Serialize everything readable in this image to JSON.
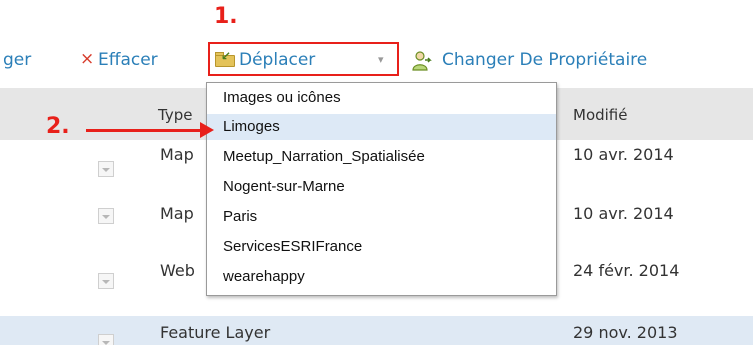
{
  "annotations": {
    "step1": "1.",
    "step2": "2."
  },
  "toolbar": {
    "partial_label": "ger",
    "delete_icon": "×",
    "delete_label": "Effacer",
    "move_label": "Déplacer",
    "move_caret": "▾",
    "change_owner_label": "Changer De Propriétaire"
  },
  "table": {
    "headers": {
      "type": "Type",
      "modified": "Modifié"
    },
    "rows": [
      {
        "type": "Map",
        "modified": "10 avr. 2014"
      },
      {
        "type": "Map",
        "modified": "10 avr. 2014"
      },
      {
        "type": "Web",
        "modified": "24 févr. 2014"
      },
      {
        "type": "Feature Layer",
        "modified": "29 nov. 2013"
      }
    ]
  },
  "dropdown": {
    "items": [
      "Images ou icônes",
      "Limoges",
      "Meetup_Narration_Spatialisée",
      "Nogent-sur-Marne",
      "Paris",
      "ServicesESRIFrance",
      "wearehappy"
    ],
    "highlighted": "Limoges"
  },
  "colors": {
    "annotation": "#e8201a",
    "link": "#2b7fb8",
    "highlight": "#dde9f6"
  }
}
